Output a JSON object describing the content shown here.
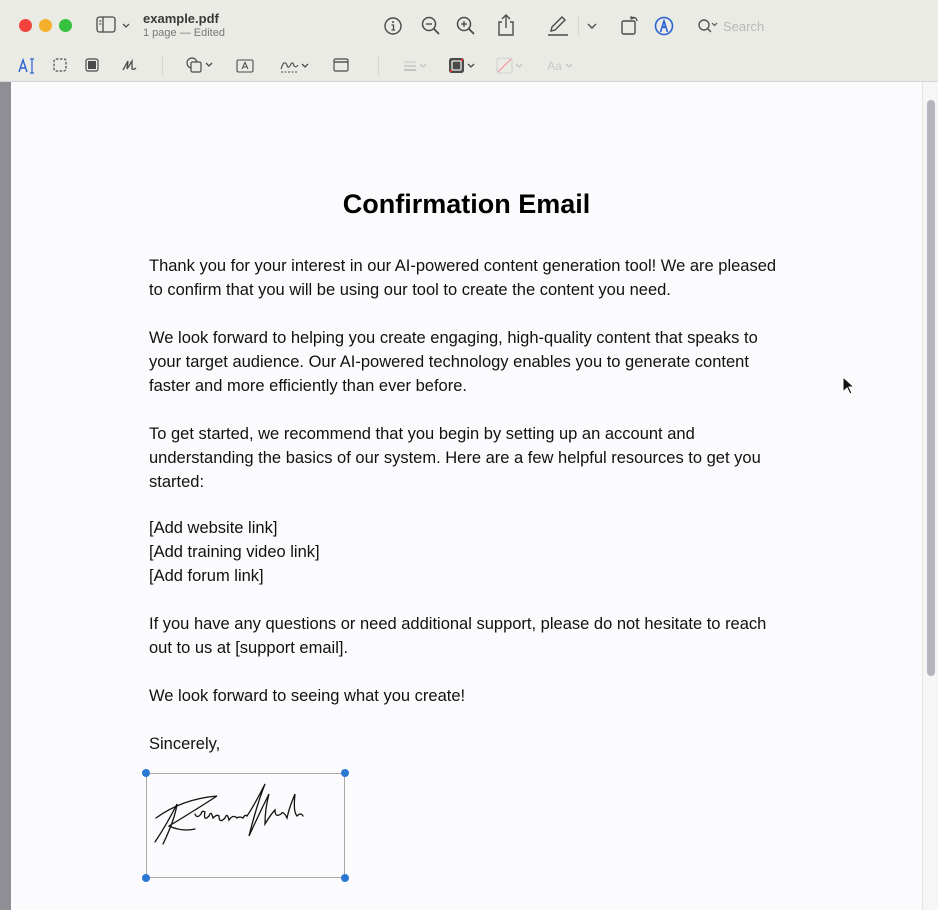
{
  "window": {
    "title": "example.pdf",
    "subtitle": "1 page — Edited",
    "controls": [
      "close",
      "minimize",
      "maximize"
    ]
  },
  "toolbar": {
    "sidebar_icon": "sidebar-icon",
    "items": [
      "info-icon",
      "zoom-out-icon",
      "zoom-in-icon",
      "share-icon",
      "highlight-pen-icon",
      "chevron-down-icon",
      "rotate-icon",
      "markup-icon"
    ],
    "search_placeholder": "Search"
  },
  "markup_toolbar": {
    "items": [
      "text-selection-icon",
      "rect-selection-icon",
      "redact-icon",
      "sketch-icon",
      "shapes-icon",
      "text-box-icon",
      "signature-icon",
      "note-icon",
      "line-style-icon",
      "border-color-icon",
      "fill-color-icon",
      "text-style-icon"
    ],
    "text_style_label": "Aa",
    "accent": "#2a62d2"
  },
  "document": {
    "heading": "Confirmation Email",
    "paragraphs": [
      "Thank you for your interest in our AI-powered content generation tool! We are pleased to confirm that you will be using our tool to create the content you need.",
      "We look forward to helping you create engaging, high-quality content that speaks to your target audience. Our AI-powered technology enables you to generate content faster and more efficiently than ever before.",
      "To get started, we recommend that you begin by setting up an account and understanding the basics of our system. Here are a few helpful resources to get you started:",
      "If you have any questions or need additional support, please do not hesitate to reach out to us at [support email].",
      "We look forward to seeing what you create!",
      "Sincerely,"
    ],
    "links": [
      "[Add website link]",
      "[Add training video link]",
      "[Add forum link]"
    ],
    "signature_text": "Robinson Clark"
  },
  "colors": {
    "selection_handle": "#2a78d2"
  }
}
